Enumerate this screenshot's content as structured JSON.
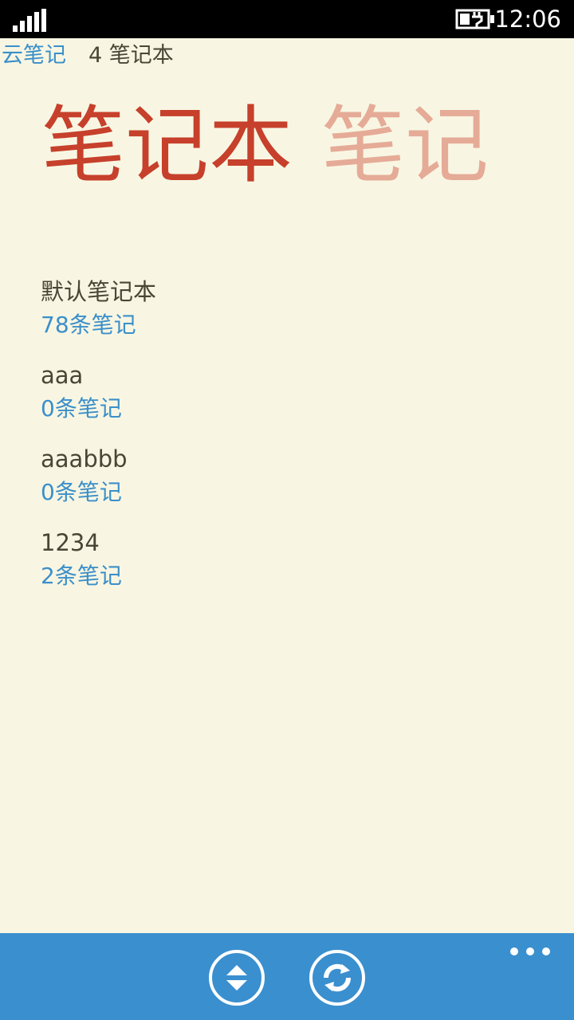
{
  "status_bar": {
    "time": "12:06",
    "signal_icon": "signal-strength-icon",
    "battery_icon": "battery-charging-icon"
  },
  "header": {
    "app_title": "云笔记",
    "notebook_count": "4 笔记本"
  },
  "pivot": {
    "items": [
      {
        "label": "笔记本",
        "active": true
      },
      {
        "label": "笔记",
        "active": false
      }
    ]
  },
  "notebooks": [
    {
      "name": "默认笔记本",
      "count": "78条笔记"
    },
    {
      "name": "aaa",
      "count": "0条笔记"
    },
    {
      "name": "aaabbb",
      "count": "0条笔记"
    },
    {
      "name": "1234",
      "count": "2条笔记"
    }
  ],
  "app_bar": {
    "buttons": [
      {
        "icon": "sort-icon"
      },
      {
        "icon": "sync-icon"
      }
    ],
    "more_icon": "more-icon"
  },
  "colors": {
    "background": "#f8f6e3",
    "accent": "#c6402b",
    "accent_muted": "#e5ab97",
    "link": "#3b8fc9",
    "text": "#4a4535",
    "app_bar": "#3a8fcf"
  }
}
